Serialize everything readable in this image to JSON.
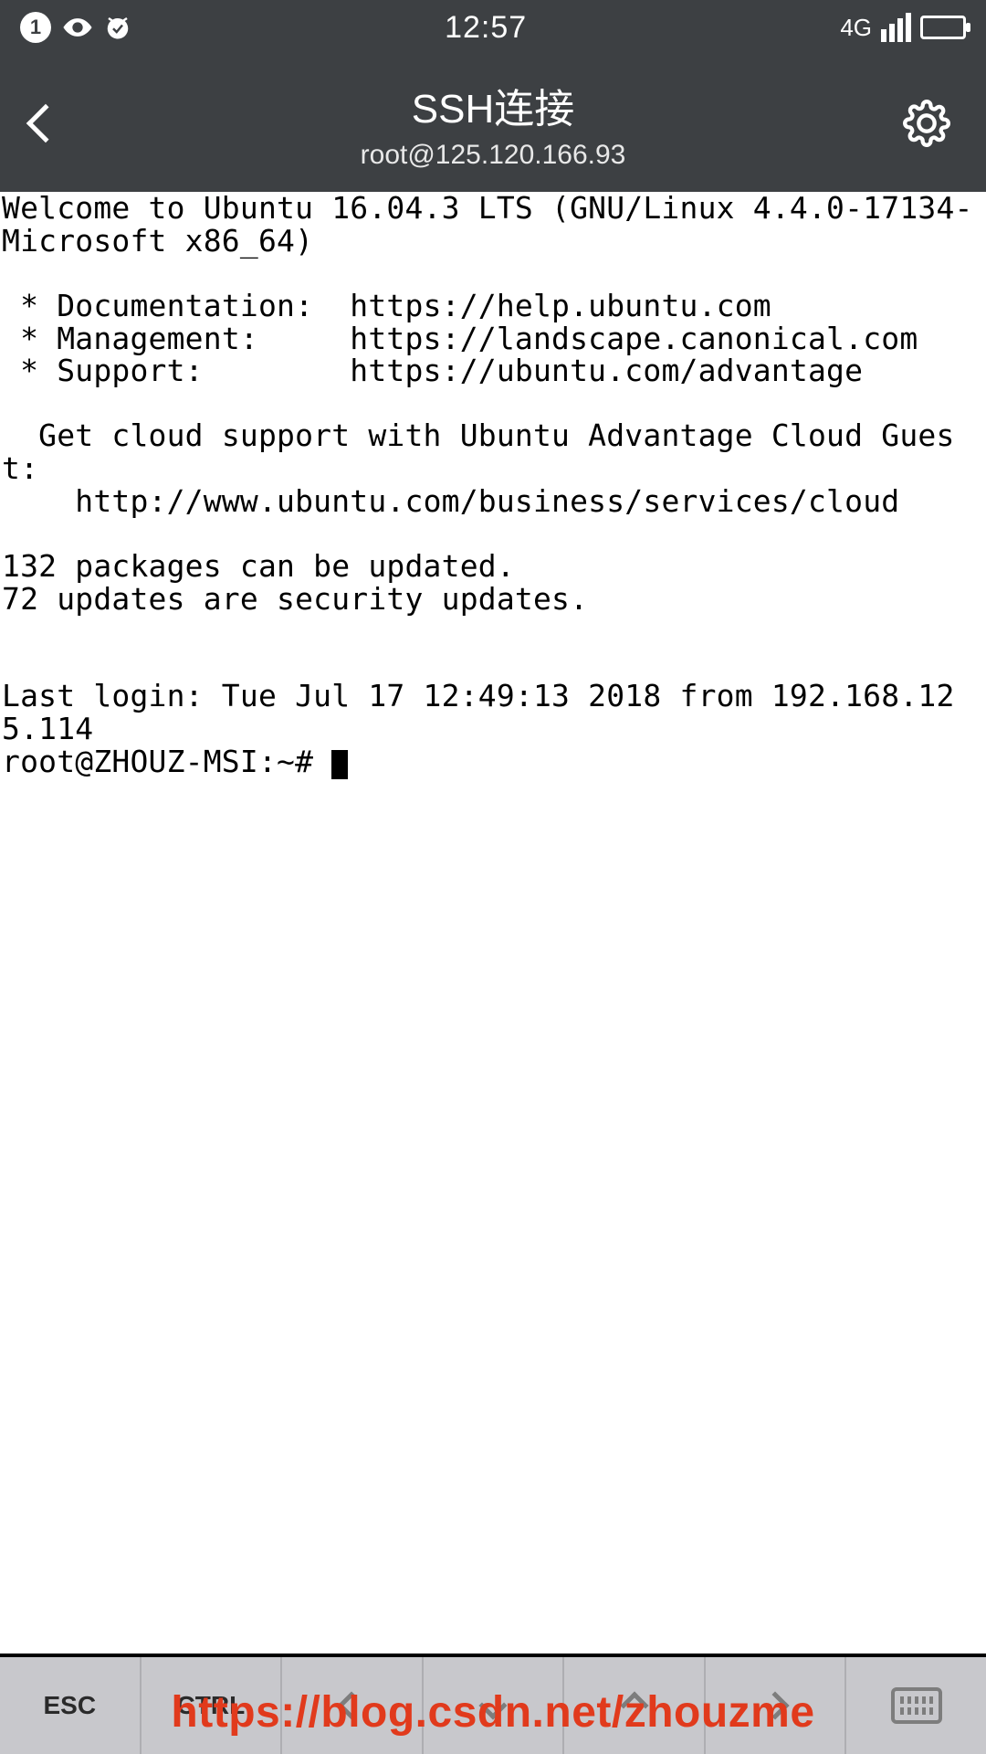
{
  "status": {
    "badge": "1",
    "time": "12:57",
    "network": "4G"
  },
  "header": {
    "title": "SSH连接",
    "subtitle": "root@125.120.166.93"
  },
  "terminal": {
    "text": "Welcome to Ubuntu 16.04.3 LTS (GNU/Linux 4.4.0-17134-Microsoft x86_64)\n\n * Documentation:  https://help.ubuntu.com\n * Management:     https://landscape.canonical.com\n * Support:        https://ubuntu.com/advantage\n\n  Get cloud support with Ubuntu Advantage Cloud Guest:\n    http://www.ubuntu.com/business/services/cloud\n\n132 packages can be updated.\n72 updates are security updates.\n\n\nLast login: Tue Jul 17 12:49:13 2018 from 192.168.125.114",
    "prompt": "root@ZHOUZ-MSI:~# "
  },
  "keys": {
    "esc": "ESC",
    "ctrl": "CTRL"
  },
  "watermark": "https://blog.csdn.net/zhouzme"
}
